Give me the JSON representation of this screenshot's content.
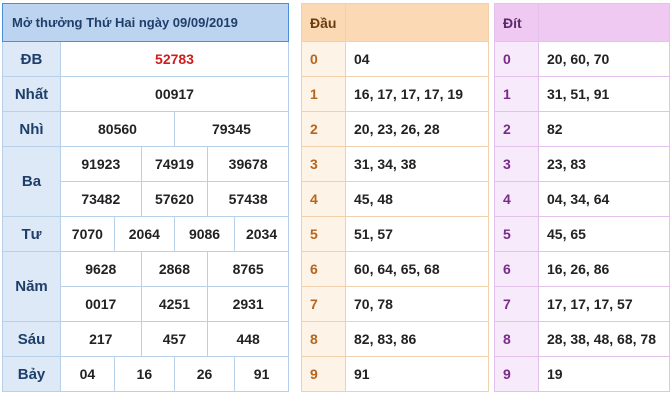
{
  "results": {
    "title": "Mở thưởng Thứ Hai ngày 09/09/2019",
    "rows": {
      "db": {
        "label": "ĐB",
        "values": [
          "52783"
        ]
      },
      "nhat": {
        "label": "Nhất",
        "values": [
          "00917"
        ]
      },
      "nhi": {
        "label": "Nhì",
        "values": [
          "80560",
          "79345"
        ]
      },
      "ba": {
        "label": "Ba",
        "values": [
          "91923",
          "74919",
          "39678",
          "73482",
          "57620",
          "57438"
        ]
      },
      "tu": {
        "label": "Tư",
        "values": [
          "7070",
          "2064",
          "9086",
          "2034"
        ]
      },
      "nam": {
        "label": "Năm",
        "values": [
          "9628",
          "2868",
          "8765",
          "0017",
          "4251",
          "2931"
        ]
      },
      "sau": {
        "label": "Sáu",
        "values": [
          "217",
          "457",
          "448"
        ]
      },
      "bay": {
        "label": "Bảy",
        "values": [
          "04",
          "16",
          "26",
          "91"
        ]
      }
    },
    "colors": {
      "border": "#4a90d9",
      "header_bg": "#bcd4ef",
      "special": "#d31b1b"
    }
  },
  "dau": {
    "header": "Đầu",
    "rows": [
      {
        "k": "0",
        "v": "04"
      },
      {
        "k": "1",
        "v": "16, 17, 17, 17, 19"
      },
      {
        "k": "2",
        "v": "20, 23, 26, 28"
      },
      {
        "k": "3",
        "v": "31, 34, 38"
      },
      {
        "k": "4",
        "v": "45, 48"
      },
      {
        "k": "5",
        "v": "51, 57"
      },
      {
        "k": "6",
        "v": "60, 64, 65, 68"
      },
      {
        "k": "7",
        "v": "70, 78"
      },
      {
        "k": "8",
        "v": "82, 83, 86"
      },
      {
        "k": "9",
        "v": "91"
      }
    ],
    "color": "#e0a96d"
  },
  "dit": {
    "header": "Đít",
    "rows": [
      {
        "k": "0",
        "v": "20, 60, 70"
      },
      {
        "k": "1",
        "v": "31, 51, 91"
      },
      {
        "k": "2",
        "v": "82"
      },
      {
        "k": "3",
        "v": "23, 83"
      },
      {
        "k": "4",
        "v": "04, 34, 64"
      },
      {
        "k": "5",
        "v": "45, 65"
      },
      {
        "k": "6",
        "v": "16, 26, 86"
      },
      {
        "k": "7",
        "v": "17, 17, 17, 57"
      },
      {
        "k": "8",
        "v": "28, 38, 48, 68, 78"
      },
      {
        "k": "9",
        "v": "19"
      }
    ],
    "color": "#c67fd6"
  }
}
